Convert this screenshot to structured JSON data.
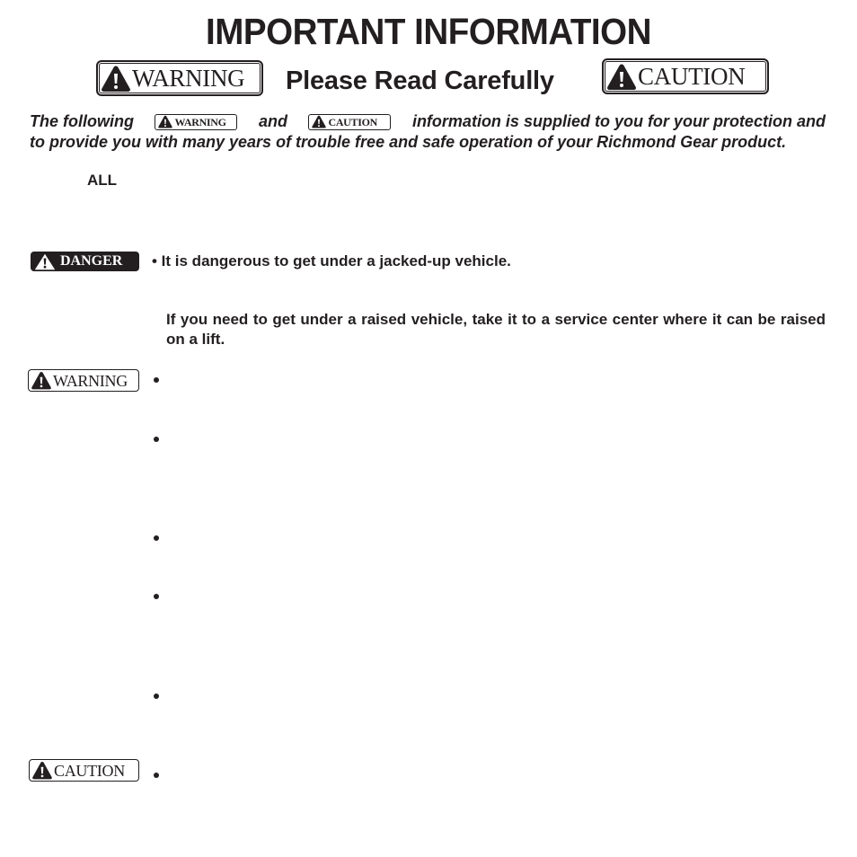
{
  "page": {
    "title": "IMPORTANT INFORMATION",
    "subtitle": "Please Read Carefully"
  },
  "tags": {
    "warning": "WARNING",
    "caution": "CAUTION",
    "danger": "DANGER"
  },
  "icons": {
    "warning_icon": "exclamation-triangle-icon"
  },
  "intro": {
    "line1_before": "The following",
    "line1_middle": "and",
    "line1_after": "information is supplied to you for your protection and",
    "line2": "to provide you with many years of trouble free and safe operation of your Richmond Gear product."
  },
  "all_label": "ALL",
  "sections": {
    "danger": {
      "tag": "DANGER",
      "bullet_text": "• It is dangerous to get under a jacked-up vehicle.",
      "paragraph": "If you need to get under a raised vehicle, take it to a service center where it can be raised on a lift."
    },
    "warning": {
      "tag": "WARNING",
      "bullet_count": 5
    },
    "caution": {
      "tag": "CAUTION",
      "bullet_count": 1
    }
  }
}
